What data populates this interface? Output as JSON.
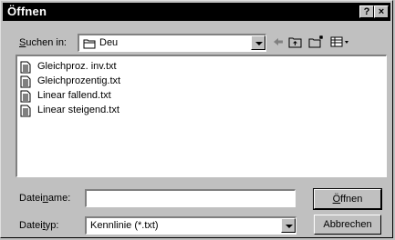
{
  "window": {
    "title": "Öffnen",
    "help_label": "?",
    "close_label": "×"
  },
  "lookin": {
    "label_pre": "",
    "label_u": "S",
    "label_post": "uchen in:",
    "value": "Deu"
  },
  "toolbar": {
    "icons": [
      "back-icon",
      "up-folder-icon",
      "new-folder-icon",
      "view-menu-icon"
    ]
  },
  "files": [
    {
      "name": "Gleichproz. inv.txt"
    },
    {
      "name": "Gleichprozentig.txt"
    },
    {
      "name": "Linear fallend.txt"
    },
    {
      "name": "Linear steigend.txt"
    }
  ],
  "filename": {
    "label_pre": "Datei",
    "label_u": "n",
    "label_post": "ame:",
    "value": ""
  },
  "filetype": {
    "label_pre": "Datei",
    "label_u": "t",
    "label_post": "yp:",
    "value": "Kennlinie (*.txt)"
  },
  "buttons": {
    "open_u": "Ö",
    "open_rest": "ffnen",
    "cancel": "Abbrechen"
  }
}
